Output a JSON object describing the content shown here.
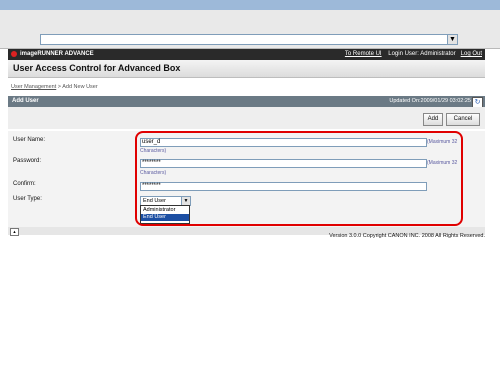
{
  "browser": {
    "dropdown_glyph": "▼"
  },
  "app": {
    "product": "imageRUNNER ADVANCE",
    "remote_ui_link": "To Remote UI",
    "login_user_text": "Login User: Administrator",
    "logout_link": "Log Out",
    "page_title": "User Access Control for Advanced Box",
    "brand_color": "#d22222"
  },
  "breadcrumb": {
    "parent": "User Management",
    "separator": " > ",
    "current": "Add New User"
  },
  "section": {
    "title": "Add User",
    "updated": "Updated On:2009/01/29 03:02:25",
    "refresh_icon": "↻"
  },
  "buttons": {
    "add": "Add",
    "cancel": "Cancel"
  },
  "form": {
    "user_name": {
      "label": "User Name:",
      "value": "user_d",
      "hint_line1": "(Maximum 32",
      "hint_line2": "Characters)"
    },
    "password": {
      "label": "Password:",
      "value": "********",
      "hint_line1": "(Maximum 32",
      "hint_line2": "Characters)"
    },
    "confirm": {
      "label": "Confirm:",
      "value": "********"
    },
    "user_type": {
      "label": "User Type:",
      "selected": "End User",
      "arrow": "▼",
      "options": [
        "Administrator",
        "End User"
      ],
      "highlighted_index": 1
    }
  },
  "footer": {
    "collapse_icon": "▲",
    "copyright": "Version 3.0.0 Copyright CANON INC. 2008 All Rights Reserved."
  }
}
